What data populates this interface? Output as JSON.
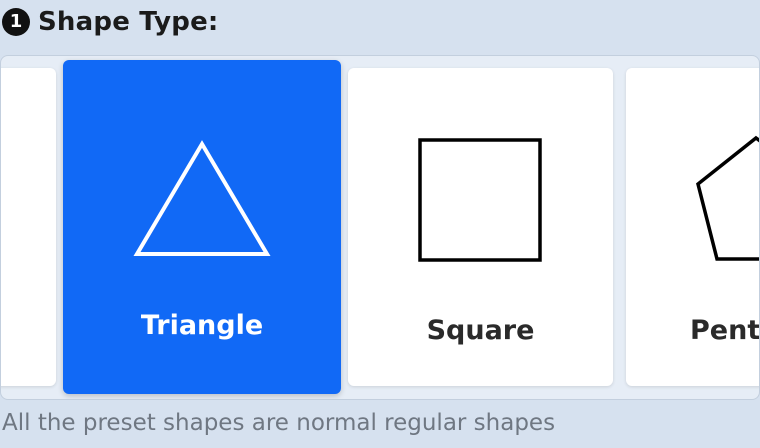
{
  "header": {
    "step_number": "1",
    "title": "Shape Type:"
  },
  "shapes": {
    "items": [
      {
        "label": "Triangle",
        "icon": "triangle-icon",
        "selected": true
      },
      {
        "label": "Square",
        "icon": "square-icon",
        "selected": false
      },
      {
        "label": "Penta",
        "icon": "pentagon-icon",
        "selected": false
      }
    ]
  },
  "footnote": "All the preset shapes are normal regular shapes",
  "colors": {
    "background": "#d6e1ef",
    "selected_card": "#1169f6",
    "card": "#ffffff",
    "footnote_text": "#6f7782"
  }
}
